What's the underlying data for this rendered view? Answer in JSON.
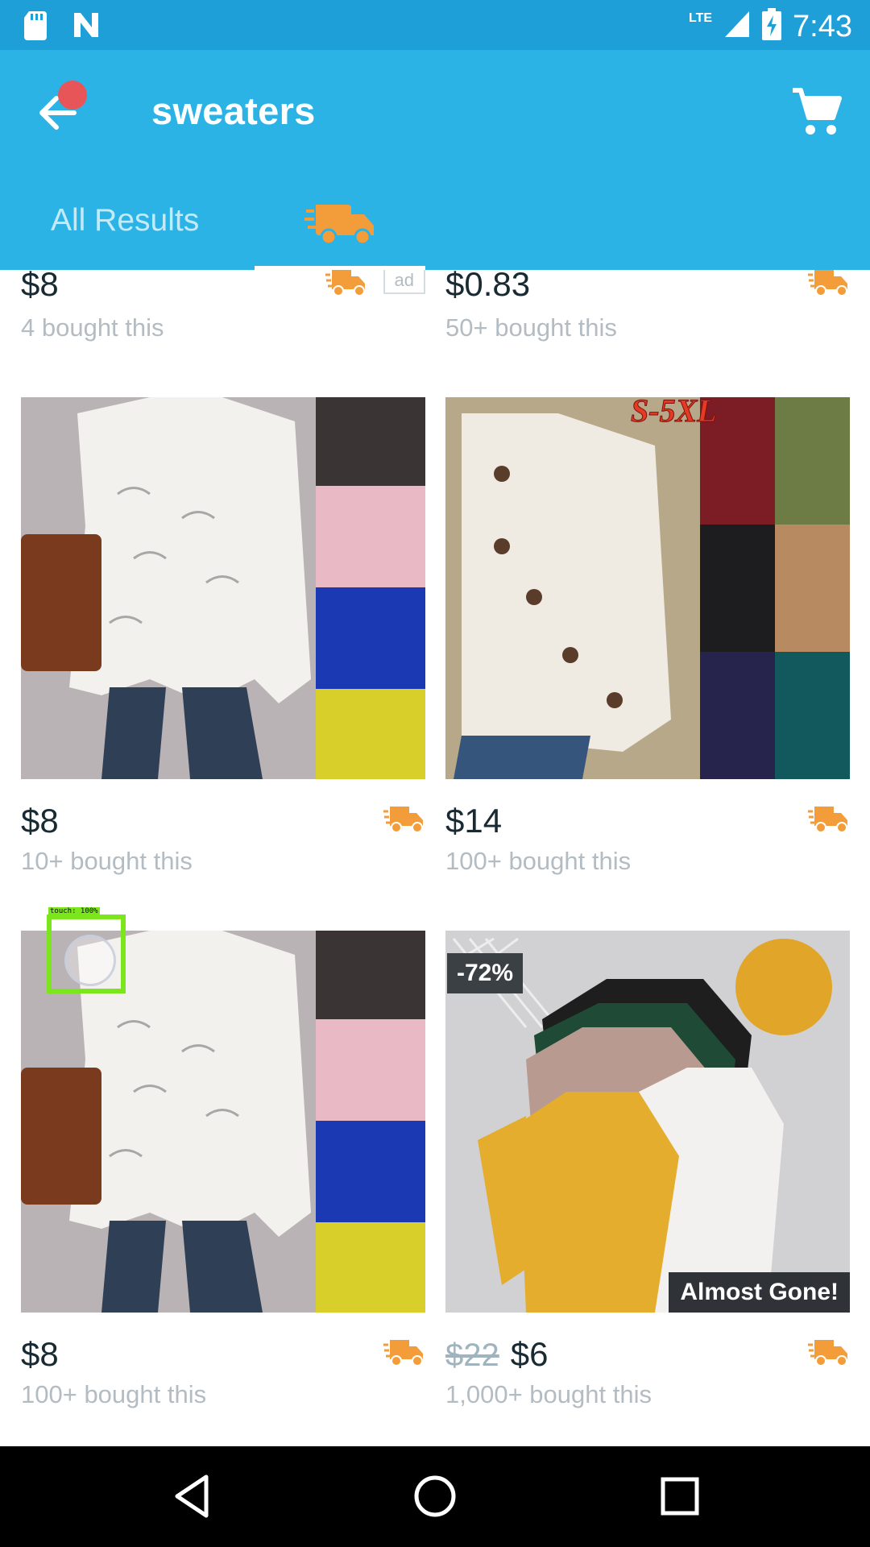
{
  "status": {
    "time": "7:43",
    "network": "LTE"
  },
  "appbar": {
    "title": "sweaters"
  },
  "tabs": [
    {
      "label": "All Results"
    }
  ],
  "products_top": [
    {
      "price": "$8",
      "sold": "4 bought this",
      "ad": "ad"
    },
    {
      "price": "$0.83",
      "sold": "50+ bought this"
    }
  ],
  "products": [
    {
      "price": "$8",
      "sold": "10+ bought this"
    },
    {
      "price": "$14",
      "sold": "100+ bought this",
      "image_text": "S-5XL"
    },
    {
      "price": "$8",
      "sold": "100+ bought this"
    },
    {
      "old_price": "$22",
      "price": "$6",
      "sold": "1,000+ bought this",
      "badge": "-72%",
      "ribbon": "Almost Gone!"
    }
  ],
  "overlay": {
    "touch_label": "touch: 100%"
  },
  "colors": {
    "status": "#1f9fd8",
    "appbar": "#2bb3e6",
    "truck": "#f39c3a",
    "notification": "#e85558"
  }
}
